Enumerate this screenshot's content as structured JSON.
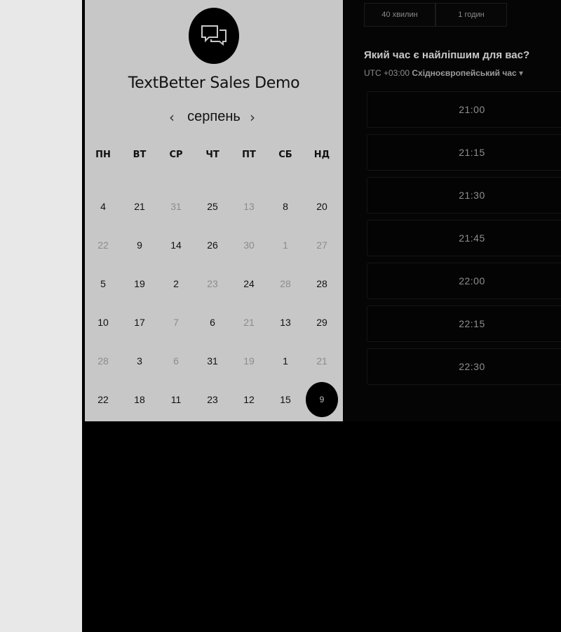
{
  "booking": {
    "title": "TextBetter Sales Demo",
    "month": "серпень",
    "prev_arrow": "‹",
    "next_arrow": "›",
    "weekdays": [
      "ПН",
      "ВТ",
      "СР",
      "ЧТ",
      "ПТ",
      "СБ",
      "НД"
    ],
    "weeks": [
      [
        "4",
        "21",
        "31",
        "25",
        "13",
        "8",
        "20"
      ],
      [
        "22",
        "9",
        "14",
        "26",
        "30",
        "1",
        "27"
      ],
      [
        "5",
        "19",
        "2",
        "23",
        "24",
        "28",
        "28"
      ],
      [
        "10",
        "17",
        "7",
        "6",
        "21",
        "13",
        "29"
      ],
      [
        "28",
        "3",
        "6",
        "31",
        "19",
        "1",
        "21"
      ],
      [
        "22",
        "18",
        "11",
        "23",
        "12",
        "15",
        "9"
      ]
    ],
    "selected_day": "9"
  },
  "durations": [
    "40 хвилин",
    "1 годин"
  ],
  "question": "Який час є найліпшим для вас?",
  "timezone": {
    "offset": "UTC +03:00",
    "name": "Східноєвропейський час",
    "caret": "▾"
  },
  "slots": [
    "21:00",
    "21:15",
    "21:30",
    "21:45",
    "22:00",
    "22:15",
    "22:30"
  ],
  "icons": {
    "logo": "chat-bubbles-icon"
  },
  "colors": {
    "panel_bg": "#c7c7c7",
    "right_bg": "#050505",
    "selected": "#000000"
  }
}
